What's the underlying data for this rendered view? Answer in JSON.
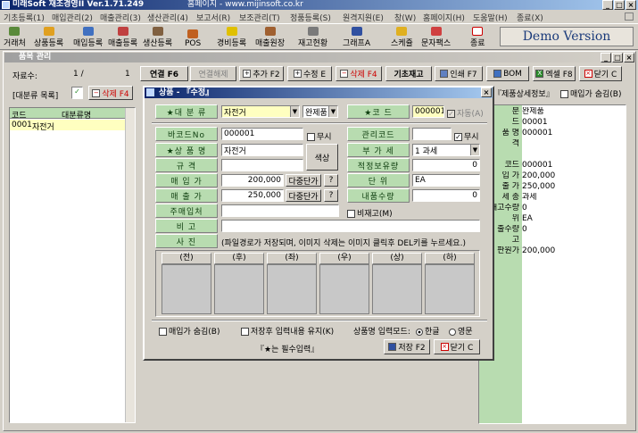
{
  "app": {
    "title": "미래Soft 재조경영II Ver.1.71.249",
    "homepage": "홈페이지 - www.mijinsoft.co.kr",
    "demo": "Demo Version"
  },
  "menu": [
    "기초등록(1)",
    "매입관리(2)",
    "매출관리(3)",
    "생산관리(4)",
    "보고서(R)",
    "보조관리(T)",
    "정품등록(S)",
    "원격지원(E)",
    "창(W)",
    "홈페이지(H)",
    "도움말(H)",
    "종료(X)"
  ],
  "toolbar": [
    "거래처",
    "상품등록",
    "매입등록",
    "매출등록",
    "생산등록",
    "POS",
    "경비등록",
    "매출원장",
    "재고현황",
    "그래프A",
    "스케쥴",
    "문자팩스",
    "종료"
  ],
  "product_window": {
    "title": "품목 관리",
    "record_label": "자료수:",
    "record_pos": "1 /",
    "record_total": "1",
    "buttons": {
      "inquiry": "연결 F6",
      "release": "연결해제",
      "add": "추가 F2",
      "edit": "수정 E",
      "delete": "삭제 F4",
      "base_stock": "기초재고",
      "print": "인쇄 F7",
      "bom": "BOM",
      "excel": "엑셀 F8",
      "close": "닫기 C"
    },
    "cat_list_btn": "[대분류 목록]",
    "cat_delete": "삭제 F4",
    "grid_headers": [
      "코드",
      "대분류명"
    ],
    "grid_rows": [
      [
        "0001",
        "자전거"
      ]
    ],
    "detail_tab": "제품상세정보",
    "hide_price": "매입가 숨김(B)"
  },
  "right_panel": {
    "labels": [
      "분",
      "드",
      "품 명",
      "격",
      "",
      "코드",
      "입 가",
      "출 가",
      "세 종",
      "재고수량",
      "위",
      "출수량",
      "고",
      "판원가"
    ],
    "values": [
      "완제품",
      "00001",
      "000001",
      "",
      "",
      "000001",
      "200,000",
      "250,000",
      "과세",
      "0",
      "EA",
      "0",
      "",
      "200,000"
    ]
  },
  "dialog": {
    "title": "상품 - 『수정』",
    "category_label": "★대 분 류",
    "category_value": "자전거",
    "category_type": "완제품",
    "code_label": "★코 드",
    "code_value": "000001",
    "auto_label": "자동(A)",
    "barcode_label": "바코드No",
    "barcode_value": "000001",
    "none_label": "무시",
    "mgmt_code_label": "관리코드",
    "mgmt_none": "무시",
    "name_label": "★상 품 명",
    "name_value": "자전거",
    "tax_label": "부 가 세",
    "tax_value": "1 과세",
    "spec_label": "규 격",
    "color_btn": "색상",
    "stock_label": "적정보유량",
    "stock_value": "0",
    "buy_label": "매 입 가",
    "buy_value": "200,000",
    "multi_price": "다중단가",
    "q": "?",
    "unit_label": "단 위",
    "unit_value": "EA",
    "sell_label": "매 출 가",
    "sell_value": "250,000",
    "internal_label": "내품수량",
    "internal_value": "0",
    "vendor_label": "주매입처",
    "nonstock_label": "비재고(M)",
    "note_label": "비 고",
    "photo_label": "사 진",
    "photo_hint": "(파일경로가 저장되며, 이미지 삭제는 이미지 클릭후 DEL키를 누르세요.)",
    "image_cols": [
      "(전)",
      "(후)",
      "(좌)",
      "(우)",
      "(상)",
      "(하)"
    ],
    "hide_buy": "매입가 숨김(B)",
    "keep_input": "저장후 입력내용 유지(K)",
    "name_mode": "상품명 입력모드:",
    "mode_kor": "한글",
    "mode_eng": "영문",
    "required": "『★는 필수입력』",
    "save": "저장 F2",
    "close": "닫기 C"
  },
  "colors": {
    "label_bg": "#b8dcb0",
    "title_dark": "#0a246a",
    "grid_header": "#b8dcb0",
    "selected_row": "#ffffc0"
  }
}
